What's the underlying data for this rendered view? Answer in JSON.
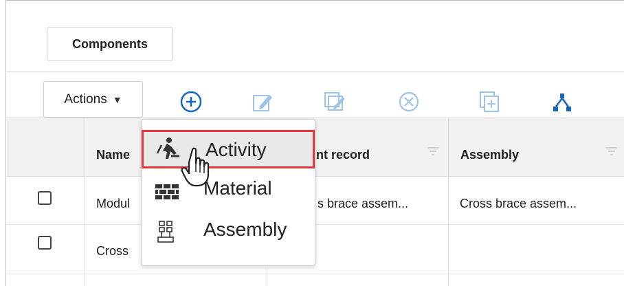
{
  "tabs": {
    "components": "Components"
  },
  "toolbar": {
    "actions_label": "Actions",
    "buttons": [
      "add-icon",
      "edit-icon",
      "edit-multiple-icon",
      "remove-icon",
      "add-to-group-icon",
      "hierarchy-icon"
    ],
    "accent_color": "#1565c0",
    "disabled_color": "#9ec3e8"
  },
  "grid": {
    "columns": [
      "Name",
      "nt record",
      "Assembly"
    ],
    "rows": [
      {
        "name": "Modul",
        "record": "s brace assem...",
        "assembly": "Cross brace assem..."
      },
      {
        "name": "Cross",
        "record": "",
        "assembly": ""
      }
    ]
  },
  "menu": {
    "items": [
      {
        "label": "Activity",
        "icon": "activity-worker-icon",
        "highlighted": true
      },
      {
        "label": "Material",
        "icon": "material-bricks-icon",
        "highlighted": false
      },
      {
        "label": "Assembly",
        "icon": "assembly-blocks-icon",
        "highlighted": false
      }
    ],
    "highlight_color": "#e2373c"
  }
}
